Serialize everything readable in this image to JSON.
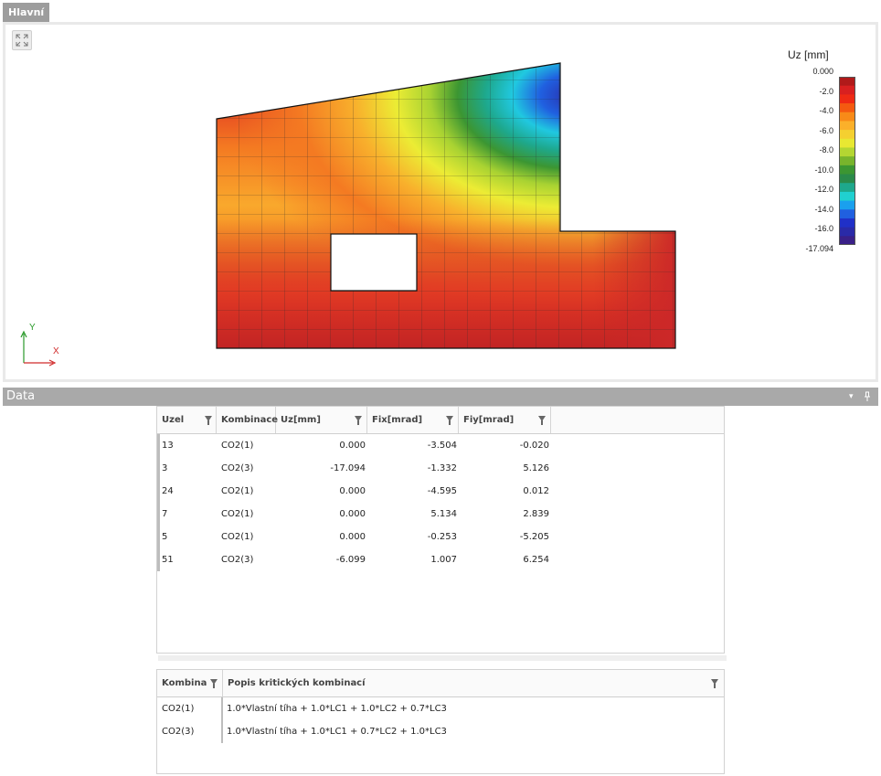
{
  "tab": {
    "label": "Hlavní"
  },
  "viewport": {
    "legend": {
      "title": "Uz [mm]",
      "labels": [
        "0.000",
        "-2.0",
        "-4.0",
        "-6.0",
        "-8.0",
        "-10.0",
        "-12.0",
        "-14.0",
        "-16.0",
        "-17.094"
      ],
      "colors": [
        "#b01a1a",
        "#d82020",
        "#ee2a14",
        "#f45a10",
        "#f88a18",
        "#fbb02a",
        "#f4d030",
        "#e8e832",
        "#b4d632",
        "#78b42c",
        "#3c9632",
        "#2a8a4a",
        "#1ea88c",
        "#20d0d0",
        "#1aa0ee",
        "#2060e0",
        "#2030c8",
        "#2a2aa8",
        "#3a2088"
      ]
    },
    "axes": {
      "x": "X",
      "y": "Y"
    },
    "icons": {
      "zoom": "fit-view-icon"
    }
  },
  "data_panel": {
    "title": "Data",
    "controls": {
      "dropdown": "▾",
      "pin": "pin-icon"
    }
  },
  "results_table": {
    "columns": [
      "Uzel",
      "Kombinace",
      "Uz[mm]",
      "Fix[mrad]",
      "Fiy[mrad]"
    ],
    "rows": [
      {
        "uzel": "13",
        "kombinace": "CO2(1)",
        "uz": "0.000",
        "fix": "-3.504",
        "fiy": "-0.020"
      },
      {
        "uzel": "3",
        "kombinace": "CO2(3)",
        "uz": "-17.094",
        "fix": "-1.332",
        "fiy": "5.126"
      },
      {
        "uzel": "24",
        "kombinace": "CO2(1)",
        "uz": "0.000",
        "fix": "-4.595",
        "fiy": "0.012"
      },
      {
        "uzel": "7",
        "kombinace": "CO2(1)",
        "uz": "0.000",
        "fix": "5.134",
        "fiy": "2.839"
      },
      {
        "uzel": "5",
        "kombinace": "CO2(1)",
        "uz": "0.000",
        "fix": "-0.253",
        "fiy": "-5.205"
      },
      {
        "uzel": "51",
        "kombinace": "CO2(3)",
        "uz": "-6.099",
        "fix": "1.007",
        "fiy": "6.254"
      }
    ]
  },
  "combo_table": {
    "columns": [
      "Kombina",
      "Popis kritických kombinací"
    ],
    "rows": [
      {
        "kombinace": "CO2(1)",
        "popis": "1.0*Vlastní tíha + 1.0*LC1 + 1.0*LC2 + 0.7*LC3"
      },
      {
        "kombinace": "CO2(3)",
        "popis": "1.0*Vlastní tíha + 1.0*LC1 + 0.7*LC2 + 1.0*LC3"
      }
    ]
  }
}
